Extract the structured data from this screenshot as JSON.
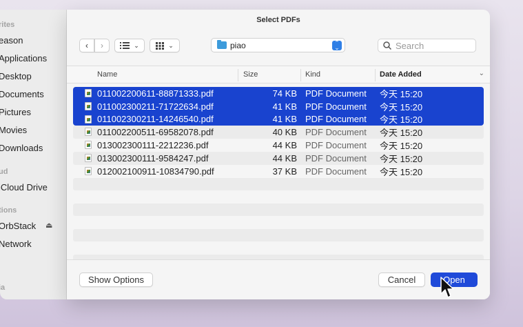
{
  "sidebar": {
    "sections": [
      {
        "label": "rites"
      },
      {
        "label": "ud"
      },
      {
        "label": "tions"
      },
      {
        "label": "ia"
      }
    ],
    "items": [
      {
        "label": "eason"
      },
      {
        "label": "Applications"
      },
      {
        "label": "Desktop"
      },
      {
        "label": "Documents"
      },
      {
        "label": "Pictures"
      },
      {
        "label": "Movies"
      },
      {
        "label": "Downloads"
      },
      {
        "label": "iCloud Drive"
      },
      {
        "label": "OrbStack"
      },
      {
        "label": "Network"
      }
    ]
  },
  "dialog": {
    "title": "Select PDFs",
    "current_folder": "piao",
    "search_placeholder": "Search"
  },
  "columns": [
    "Name",
    "Size",
    "Kind",
    "Date Added"
  ],
  "files": [
    {
      "name": "011002200611-88871333.pdf",
      "size": "74 KB",
      "kind": "PDF Document",
      "date": "今天 15:20",
      "selected": true
    },
    {
      "name": "011002300211-71722634.pdf",
      "size": "41 KB",
      "kind": "PDF Document",
      "date": "今天 15:20",
      "selected": true
    },
    {
      "name": "011002300211-14246540.pdf",
      "size": "41 KB",
      "kind": "PDF Document",
      "date": "今天 15:20",
      "selected": true
    },
    {
      "name": "011002200511-69582078.pdf",
      "size": "40 KB",
      "kind": "PDF Document",
      "date": "今天 15:20",
      "selected": false
    },
    {
      "name": "013002300111-2212236.pdf",
      "size": "44 KB",
      "kind": "PDF Document",
      "date": "今天 15:20",
      "selected": false
    },
    {
      "name": "013002300111-9584247.pdf",
      "size": "44 KB",
      "kind": "PDF Document",
      "date": "今天 15:20",
      "selected": false
    },
    {
      "name": "012002100911-10834790.pdf",
      "size": "37 KB",
      "kind": "PDF Document",
      "date": "今天 15:20",
      "selected": false
    }
  ],
  "buttons": {
    "show_options": "Show Options",
    "cancel": "Cancel",
    "open": "Open"
  },
  "colors": {
    "selection": "#1943cf",
    "accent": "#1f4ad9"
  }
}
